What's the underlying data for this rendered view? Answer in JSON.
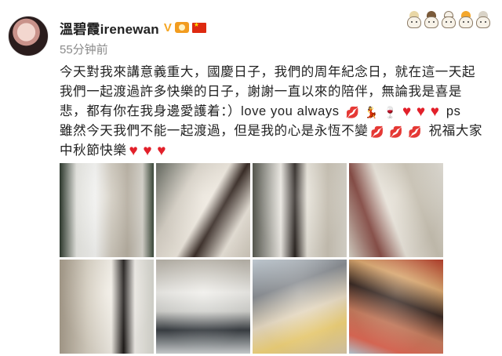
{
  "post": {
    "username": "溫碧霞irenewan",
    "verified_mark": "V",
    "timestamp": "55分钟前",
    "lines": {
      "l1": "今天對我來講意義重大，國慶日子，我們的周年紀念日，就在這一天起",
      "l2": "我們一起渡過許多快樂的日子，謝謝一直以來的陪伴，無論我是喜是",
      "l3_text": "悲，都有你在我身邊愛護着：）love you always",
      "l3_tail": "ps",
      "l4_text": "雖然今天我們不能一起渡過，但是我的心是永恆不變",
      "l4_tail": "祝福大家",
      "l5_text": "中秋節快樂"
    },
    "emoji": {
      "kiss": "💋",
      "dancer": "💃",
      "wine": "🍷",
      "heart": "♥"
    }
  },
  "icons": {
    "avatar": "avatar",
    "level": "level-badge-icon",
    "flag": "china-flag-icon",
    "decor": "cartoon-pets-decoration-icon"
  },
  "colors": {
    "username": "#222222",
    "verified": "#f6a623",
    "timestamp": "#8a8a8a",
    "heart": "#e2202a"
  },
  "photos": [
    {
      "label": ""
    },
    {
      "label": ""
    },
    {
      "label": ""
    },
    {
      "label": ""
    },
    {
      "label": ""
    },
    {
      "label": ""
    },
    {
      "label": ""
    },
    {
      "label": ""
    }
  ]
}
